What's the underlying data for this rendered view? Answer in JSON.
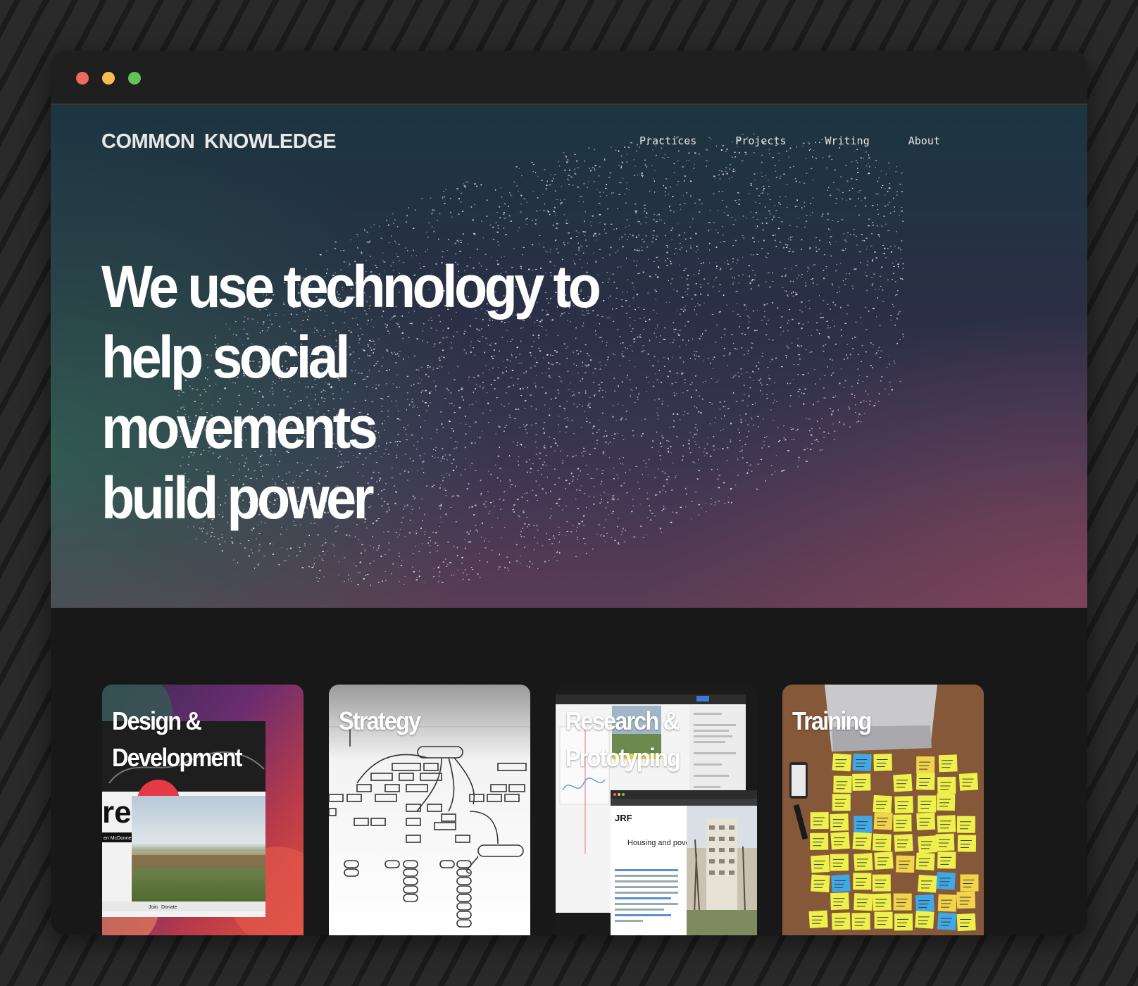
{
  "window": {
    "controls": [
      "close",
      "minimize",
      "maximize"
    ]
  },
  "site": {
    "brand": "COMMON KNOWLEDGE",
    "nav": [
      {
        "label": "Practices"
      },
      {
        "label": "Projects"
      },
      {
        "label": "Writing"
      },
      {
        "label": "About"
      }
    ],
    "headline": [
      "We use technology to",
      "help social movements",
      "build power"
    ]
  },
  "cards": [
    {
      "label": "Design & Development",
      "image": "collage of website mockups on painted background"
    },
    {
      "label": "Strategy",
      "image": "hand-drawn flow diagram"
    },
    {
      "label": "Research & Prototyping",
      "image": "screenshots of prototype app with Housing and poverty page"
    },
    {
      "label": "Training",
      "image": "yellow and blue sticky notes on wooden table"
    }
  ],
  "card_images_text": {
    "jrf_logo": "JRF",
    "jrf_title": "Housing and poverty",
    "mockup_name": "en McDonnell",
    "mockup_buttons": [
      "Join",
      "Donate"
    ]
  },
  "colors": {
    "window_bg": "#181818",
    "titlebar": "#1f1f1f",
    "close": "#ec6a5e",
    "minimize": "#f4bf4f",
    "maximize": "#61c554"
  }
}
